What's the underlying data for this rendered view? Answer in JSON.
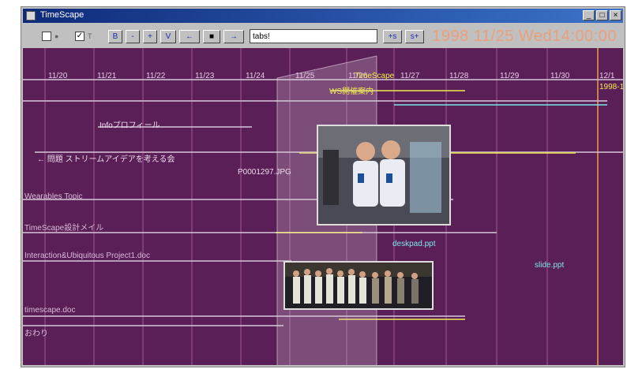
{
  "window": {
    "title": "TimeScape"
  },
  "toolbar": {
    "buttons": [
      "B",
      "-",
      "+",
      "V",
      "←",
      "■",
      "→"
    ],
    "query_value": "tabs!",
    "prev_label": "+s",
    "next_label": "s+",
    "clock": "1998 11/25 Wed14:00:00"
  },
  "timeline": {
    "dates": [
      "11/20",
      "11/21",
      "11/22",
      "11/23",
      "11/24",
      "11/25",
      "11/26",
      "11/27",
      "11/28",
      "11/29",
      "11/30",
      "12/1"
    ],
    "events": [
      {
        "text": "TimeScape",
        "color": "yellow"
      },
      {
        "text": "WS開催案内",
        "color": "yellow"
      },
      {
        "text": "1998-1",
        "color": "yellow"
      },
      {
        "text": "Infoプロフィール",
        "color": "white"
      },
      {
        "text": "← 問題 ストリームアイデアを考える会",
        "color": "white"
      },
      {
        "text": "P0001297.JPG",
        "color": "white"
      },
      {
        "text": "Wearables Topic",
        "color": "pink"
      },
      {
        "text": "TimeScape設計メイル",
        "color": "pink"
      },
      {
        "text": "Interaction&Ubiquitous Project1.doc",
        "color": "pink"
      },
      {
        "text": "timescape.doc",
        "color": "pink"
      },
      {
        "text": "おわり",
        "color": "pink"
      },
      {
        "text": "deskpad.ppt",
        "color": "cyan"
      },
      {
        "text": "slide.ppt",
        "color": "cyan"
      }
    ]
  },
  "colors": {
    "background": "#5b1f57",
    "grid": "#b96aa8",
    "accent": "#f2ea52",
    "link": "#7fe3ec"
  }
}
